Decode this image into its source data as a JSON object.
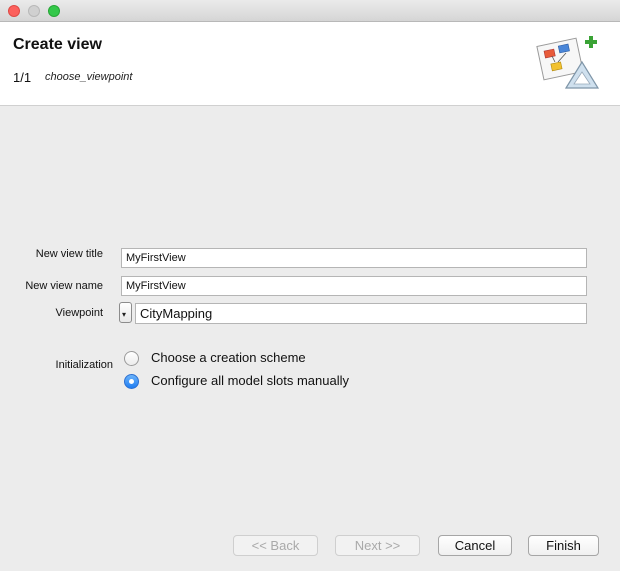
{
  "header": {
    "title": "Create view",
    "step": "1/1",
    "subtitle": "choose_viewpoint",
    "icon": "wizard-diagram-icon"
  },
  "form": {
    "view_title_label": "New view title",
    "view_title_value": "MyFirstView",
    "view_name_label": "New view name",
    "view_name_value": "MyFirstView",
    "viewpoint_label": "Viewpoint",
    "viewpoint_value": "CityMapping",
    "initialization_label": "Initialization",
    "options": [
      {
        "label": "Choose a creation scheme",
        "selected": false
      },
      {
        "label": "Configure all model slots manually",
        "selected": true
      }
    ]
  },
  "buttons": {
    "back": "<< Back",
    "next": "Next >>",
    "cancel": "Cancel",
    "finish": "Finish"
  },
  "colors": {
    "accent": "#1f7ef2",
    "close": "#fc605c",
    "maximize": "#34c84a"
  }
}
